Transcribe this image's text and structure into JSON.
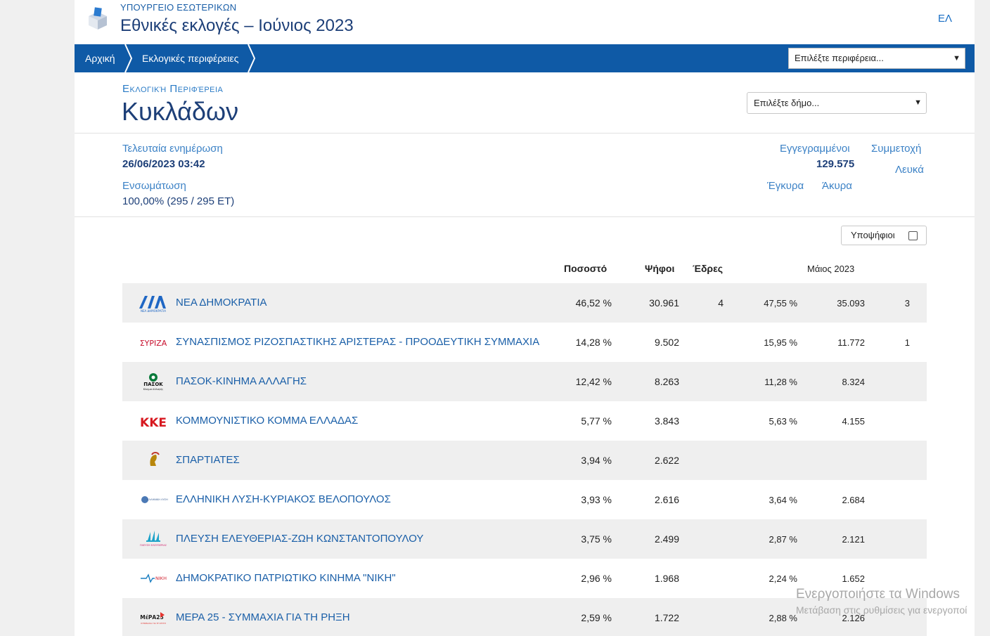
{
  "header": {
    "ministry": "ΥΠΟΥΡΓΕΙΟ ΕΣΩΤΕΡΙΚΩΝ",
    "title": "Εθνικές εκλογές – Ιούνιος 2023",
    "lang": "ΕΛ",
    "logo_icon": "ballot-box-icon"
  },
  "nav": {
    "crumbs": [
      "Αρχική",
      "Εκλογικές περιφέρειες"
    ],
    "region_select_placeholder": "Επιλέξτε περιφέρεια..."
  },
  "region": {
    "label": "Εκλογική Περιφέρεια",
    "name": "Κυκλάδων",
    "municipality_placeholder": "Επιλέξτε δήμο..."
  },
  "stats": {
    "last_update_label": "Τελευταία ενημέρωση",
    "last_update_value": "26/06/2023 03:42",
    "integration_label": "Ενσωμάτωση",
    "integration_value": "100,00% (295 / 295 ΕΤ)",
    "registered_label": "Εγγεγραμμένοι",
    "registered_value": "129.575",
    "turnout_label": "Συμμετοχή",
    "blank_label": "Λευκά",
    "valid_label": "Έγκυρα",
    "invalid_label": "Άκυρα"
  },
  "candidates_toggle": {
    "label": "Υποψήφιοι",
    "checked": false
  },
  "table": {
    "headers": {
      "pct": "Ποσοστό",
      "votes": "Ψήφοι",
      "seats": "Έδρες",
      "may": "Μάιος 2023"
    },
    "rows": [
      {
        "name": "ΝΕΑ ΔΗΜΟΚΡΑΤΙΑ",
        "pct": "46,52 %",
        "votes": "30.961",
        "seats": "4",
        "may_pct": "47,55 %",
        "may_votes": "35.093",
        "may_seats": "3",
        "logo": "nd-logo"
      },
      {
        "name": "ΣΥΝΑΣΠΙΣΜΟΣ ΡΙΖΟΣΠΑΣΤΙΚΗΣ ΑΡΙΣΤΕΡΑΣ - ΠΡΟΟΔΕΥΤΙΚΗ ΣΥΜΜΑΧΙΑ",
        "pct": "14,28 %",
        "votes": "9.502",
        "seats": "",
        "may_pct": "15,95 %",
        "may_votes": "11.772",
        "may_seats": "1",
        "logo": "syriza-logo"
      },
      {
        "name": "ΠΑΣΟΚ-ΚΙΝΗΜΑ ΑΛΛΑΓΗΣ",
        "pct": "12,42 %",
        "votes": "8.263",
        "seats": "",
        "may_pct": "11,28 %",
        "may_votes": "8.324",
        "may_seats": "",
        "logo": "pasok-logo"
      },
      {
        "name": "ΚΟΜΜΟΥΝΙΣΤΙΚΟ ΚΟΜΜΑ ΕΛΛΑΔΑΣ",
        "pct": "5,77 %",
        "votes": "3.843",
        "seats": "",
        "may_pct": "5,63 %",
        "may_votes": "4.155",
        "may_seats": "",
        "logo": "kke-logo"
      },
      {
        "name": "ΣΠΑΡΤΙΑΤΕΣ",
        "pct": "3,94 %",
        "votes": "2.622",
        "seats": "",
        "may_pct": "",
        "may_votes": "",
        "may_seats": "",
        "logo": "spartiates-logo"
      },
      {
        "name": "ΕΛΛΗΝΙΚΗ ΛΥΣΗ-ΚΥΡΙΑΚΟΣ ΒΕΛΟΠΟΥΛΟΣ",
        "pct": "3,93 %",
        "votes": "2.616",
        "seats": "",
        "may_pct": "3,64 %",
        "may_votes": "2.684",
        "may_seats": "",
        "logo": "elliniki-lysi-logo"
      },
      {
        "name": "ΠΛΕΥΣΗ ΕΛΕΥΘΕΡΙΑΣ-ΖΩΗ ΚΩΝΣΤΑΝΤΟΠΟΥΛΟΥ",
        "pct": "3,75 %",
        "votes": "2.499",
        "seats": "",
        "may_pct": "2,87 %",
        "may_votes": "2.121",
        "may_seats": "",
        "logo": "plefsi-logo"
      },
      {
        "name": "ΔΗΜΟΚΡΑΤΙΚΟ ΠΑΤΡΙΩΤΙΚΟ ΚΙΝΗΜΑ \"ΝΙΚΗ\"",
        "pct": "2,96 %",
        "votes": "1.968",
        "seats": "",
        "may_pct": "2,24 %",
        "may_votes": "1.652",
        "may_seats": "",
        "logo": "niki-logo"
      },
      {
        "name": "ΜΕΡΑ 25 - ΣΥΜΜΑΧΙΑ ΓΙΑ ΤΗ ΡΗΞΗ",
        "pct": "2,59 %",
        "votes": "1.722",
        "seats": "",
        "may_pct": "2,88 %",
        "may_votes": "2.126",
        "may_seats": "",
        "logo": "mera25-logo"
      }
    ]
  },
  "logo_text": {
    "nd": "ΝΔ",
    "nd_caption": "ΝΕΑ ΔΗΜΟΚΡΑΤΙΑ",
    "syriza": "ΣΥΡΙΖΑ",
    "pasok": "ΠΑΣΟΚ",
    "pasok_caption": "Κίνημα Αλλαγής",
    "kke": "ΚΚΕ",
    "elliniki_lysi": "ΕΛΛΗΝΙΚΗ ΛΥΣΗ",
    "plefsi": "ΠΛΕΥΣΗ ΕΛΕΥΘΕΡΙΑΣ",
    "niki": "ΝΙΚΗ",
    "mera25": "ΜέΡΑ25",
    "mera25_caption": "ΣΥΜΜΑΧΙΑ ΓΙΑ ΤΗ ΡΗΞΗ"
  },
  "watermark": {
    "line1": "Ενεργοποιήστε τα Windows",
    "line2": "Μετάβαση στις ρυθμίσεις για ενεργοποί"
  },
  "colors": {
    "nav_bg": "#0f5aa6",
    "title": "#1d3f78",
    "link": "#1a5fa8",
    "row_shade": "#efefef"
  }
}
